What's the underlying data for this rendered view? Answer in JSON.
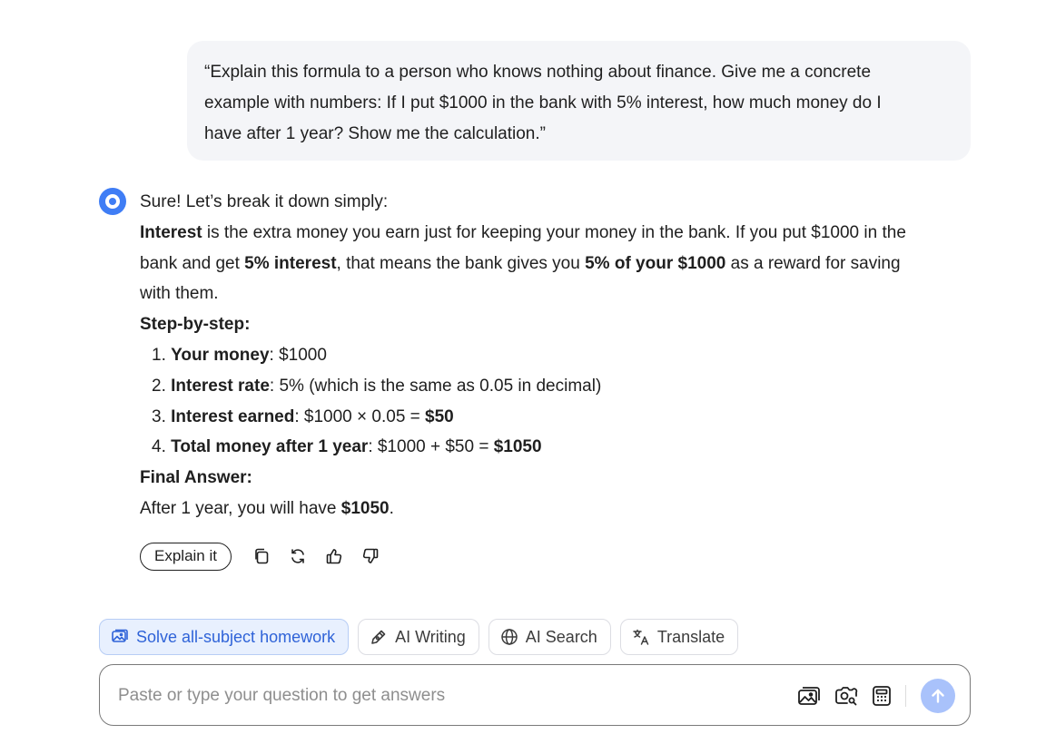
{
  "user_message": {
    "line1": "“Explain this formula to a person who knows nothing about finance. Give me a concrete",
    "line2": "example with numbers: If I put $1000 in the bank with 5% interest, how much money do I",
    "line3": "have after 1 year? Show me the calculation.”"
  },
  "answer": {
    "intro": "Sure! Let’s break it down simply:",
    "p1_b1": "Interest",
    "p1_t1": " is the extra money you earn just for keeping your money in the bank. If you put $1000 in the",
    "p1_t2": "bank and get ",
    "p1_b2": "5% interest",
    "p1_t3": ", that means the bank gives you ",
    "p1_b3": "5% of your $1000",
    "p1_t4": " as a reward for saving",
    "p1_t5": "with them.",
    "steps_heading": "Step-by-step:",
    "steps": [
      {
        "num": "1. ",
        "label": "Your money",
        "text": ": $1000",
        "bold_tail": ""
      },
      {
        "num": "2. ",
        "label": "Interest rate",
        "text": ": 5% (which is the same as 0.05 in decimal)",
        "bold_tail": ""
      },
      {
        "num": "3. ",
        "label": "Interest earned",
        "text": ": $1000 × 0.05 = ",
        "bold_tail": "$50"
      },
      {
        "num": "4. ",
        "label": "Total money after 1 year",
        "text": ": $1000 + $50 = ",
        "bold_tail": "$1050"
      }
    ],
    "final_heading": "Final Answer:",
    "final_text": "After 1 year, you will have ",
    "final_bold": "$1050",
    "final_end": "."
  },
  "actions": {
    "explain_label": "Explain it",
    "icons": [
      "copy-icon",
      "regenerate-icon",
      "thumbs-up-icon",
      "thumbs-down-icon"
    ]
  },
  "chips": [
    {
      "label": "Solve all-subject homework",
      "icon": "homework-icon",
      "active": true
    },
    {
      "label": "AI Writing",
      "icon": "pen-icon",
      "active": false
    },
    {
      "label": "AI Search",
      "icon": "globe-icon",
      "active": false
    },
    {
      "label": "Translate",
      "icon": "translate-icon",
      "active": false
    }
  ],
  "input": {
    "placeholder": "Paste or type your question to get answers",
    "value": "",
    "tools": [
      "image-upload-icon",
      "camera-search-icon",
      "calculator-icon"
    ]
  },
  "colors": {
    "accent": "#3f7df5",
    "chip_active_bg": "#e8f0fe",
    "chip_active_text": "#2f63d8",
    "send_disabled": "#a9c2fb",
    "bubble_bg": "#f4f5f8"
  }
}
